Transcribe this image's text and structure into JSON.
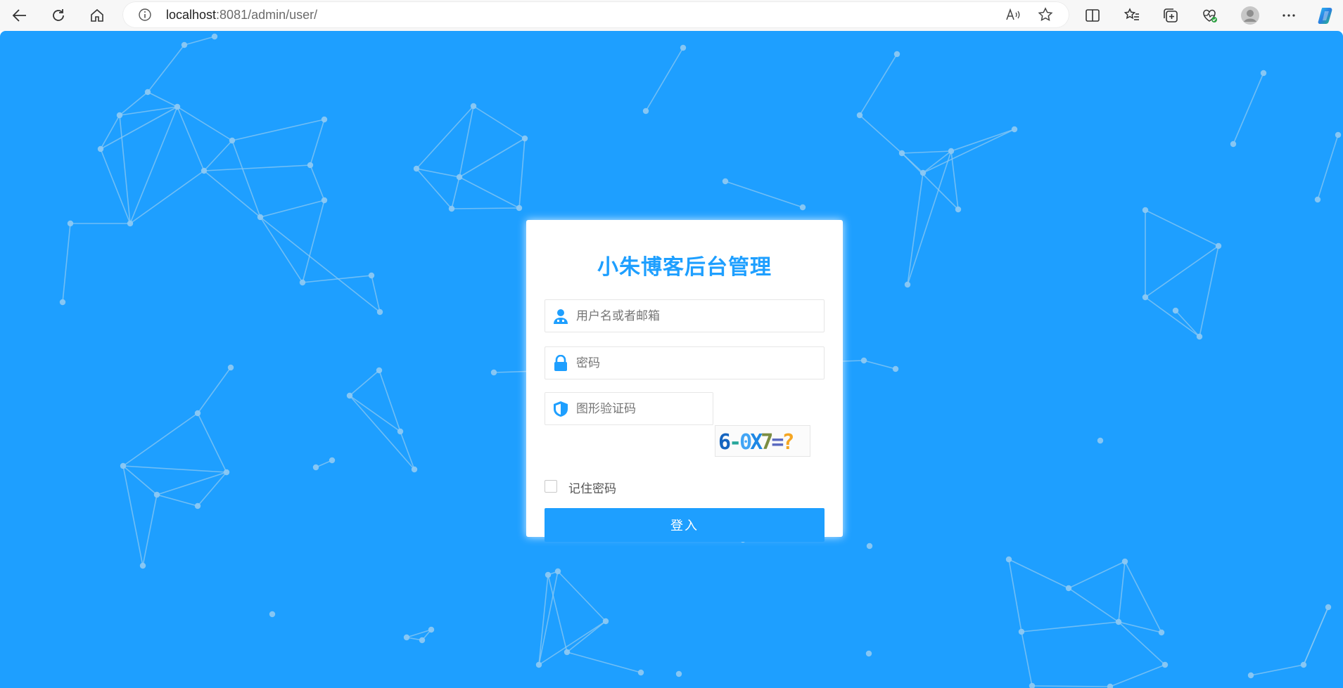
{
  "browser": {
    "url_host": "localhost",
    "url_rest": ":8081/admin/user/",
    "icons": [
      "back-icon",
      "refresh-icon",
      "home-icon",
      "info-icon",
      "read-aloud-icon",
      "favorite-star-icon",
      "split-screen-icon",
      "favorites-list-icon",
      "collections-icon",
      "browser-essentials-icon",
      "profile-icon",
      "more-icon",
      "copilot-icon"
    ]
  },
  "login": {
    "title": "小朱博客后台管理",
    "username_placeholder": "用户名或者邮箱",
    "password_placeholder": "密码",
    "captcha_placeholder": "图形验证码",
    "captcha_text": "6-0X7=?",
    "remember_label": "记住密码",
    "remember_checked": false,
    "submit_label": "登入"
  },
  "colors": {
    "background": "#1e9fff",
    "accent": "#1e9fff",
    "network_line": "#8cc8f2",
    "card": "#ffffff"
  }
}
